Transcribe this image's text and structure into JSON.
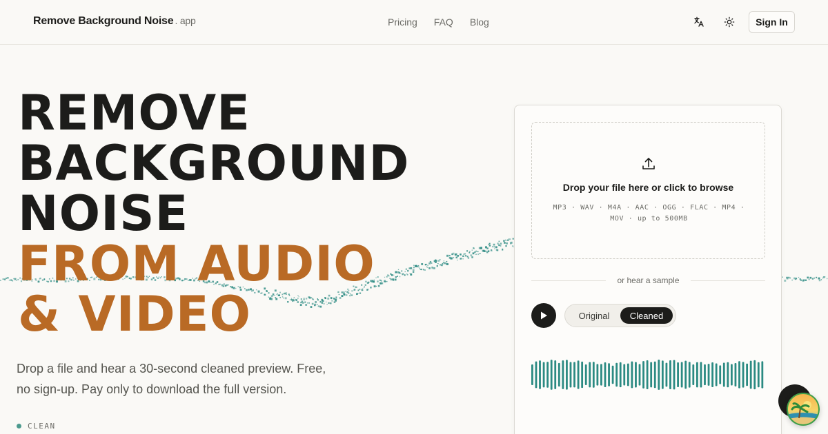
{
  "header": {
    "brand": "Remove Background Noise",
    "brand_suffix": ". app",
    "nav": [
      "Pricing",
      "FAQ",
      "Blog"
    ],
    "signin_label": "Sign In"
  },
  "hero": {
    "title_lines": [
      "REMOVE",
      "BACKGROUND",
      "NOISE",
      "FROM AUDIO",
      "& VIDEO"
    ],
    "subtitle": "Drop a file and hear a 30-second cleaned preview. Free, no sign-up. Pay only to download the full version.",
    "status_label": "CLEAN"
  },
  "upload": {
    "title": "Drop your file here or click to browse",
    "formats": "MP3 · WAV · M4A · AAC · OGG · FLAC · MP4 · MOV · up to 500MB",
    "sample_divider": "or hear a sample",
    "toggle": {
      "original": "Original",
      "cleaned": "Cleaned",
      "selected": "Cleaned"
    }
  },
  "colors": {
    "accent": "#b96a25",
    "teal": "#2b8a82",
    "ink": "#1c1c1a",
    "background": "#faf9f6"
  },
  "icons": {
    "translate": "translate-icon",
    "theme": "sun-icon",
    "upload": "upload-icon",
    "play": "play-icon"
  }
}
